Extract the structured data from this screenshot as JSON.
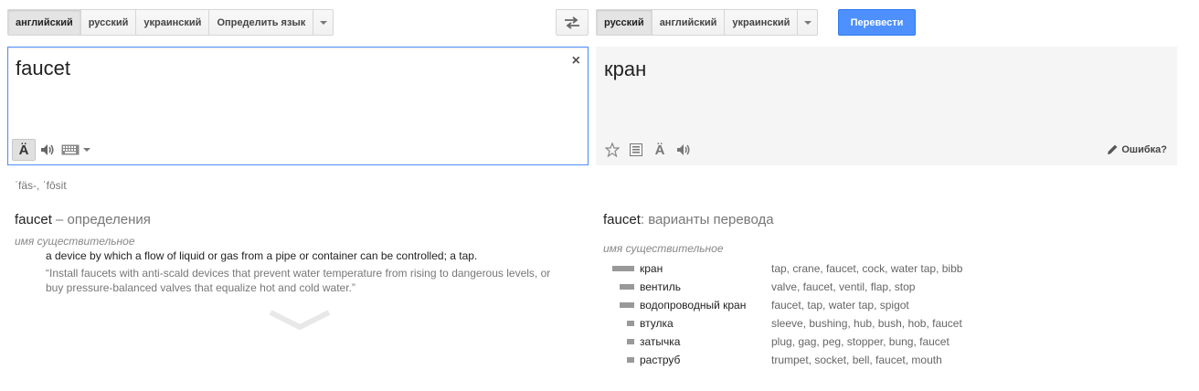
{
  "source_langs": {
    "items": [
      "английский",
      "русский",
      "украинский",
      "Определить язык"
    ],
    "active_index": 0
  },
  "target_langs": {
    "items": [
      "русский",
      "английский",
      "украинский"
    ],
    "active_index": 0
  },
  "translate_button": "Перевести",
  "source": {
    "text": "faucet",
    "clear_glyph": "×",
    "transliteration": "ˈfäs-, ˈfôsit"
  },
  "target": {
    "text": "кран",
    "report_label": "Ошибка?"
  },
  "definitions": {
    "word": "faucet",
    "heading_suffix": " – определения",
    "pos": "имя существительное",
    "entries": [
      {
        "definition": "a device by which a flow of liquid or gas from a pipe or container can be controlled; a tap.",
        "example": "“Install faucets with anti-scald devices that prevent water temperature from rising to dangerous levels, or buy pressure-balanced valves that equalize hot and cold water.”"
      }
    ]
  },
  "translations": {
    "word": "faucet",
    "heading_suffix": ": варианты перевода",
    "pos": "имя существительное",
    "rows": [
      {
        "word": "кран",
        "reverse": "tap, crane, faucet, cock, water tap, bibb",
        "frequency": 1.0
      },
      {
        "word": "вентиль",
        "reverse": "valve, faucet, ventil, flap, stop",
        "frequency": 0.66
      },
      {
        "word": "водопроводный кран",
        "reverse": "faucet, tap, water tap, spigot",
        "frequency": 0.66
      },
      {
        "word": "втулка",
        "reverse": "sleeve, bushing, hub, bush, hob, faucet",
        "frequency": 0.33
      },
      {
        "word": "затычка",
        "reverse": "plug, gag, peg, stopper, bung, faucet",
        "frequency": 0.33
      },
      {
        "word": "раструб",
        "reverse": "trumpet, socket, bell, faucet, mouth",
        "frequency": 0.33
      }
    ]
  },
  "icons": {
    "virtual_keyboard": "keyboard-icon",
    "listen": "speaker-icon",
    "input_tools": "umlaut-a-icon",
    "star": "star-icon",
    "swap": "swap-arrows-icon",
    "report": "pencil-icon"
  }
}
